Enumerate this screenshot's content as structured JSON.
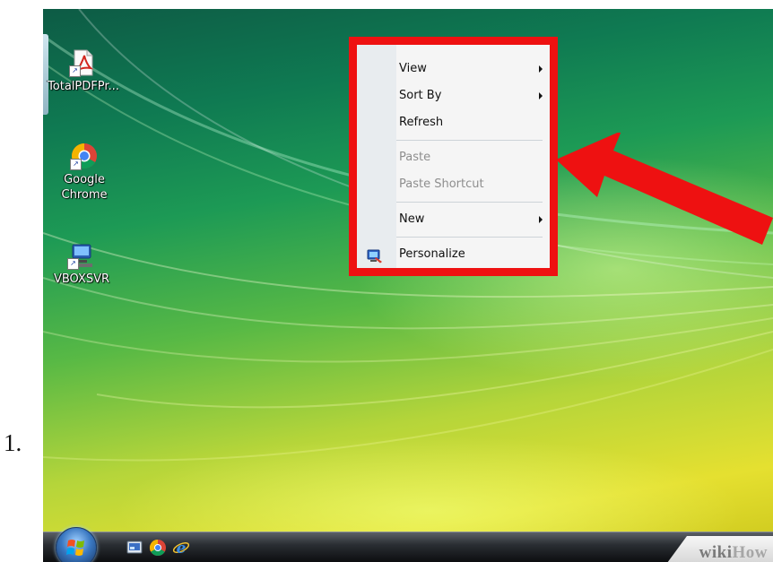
{
  "list_marker": "1.",
  "desktop": {
    "icons": [
      {
        "label": "TotalPDFPr...",
        "icon": "pdf-document-icon"
      },
      {
        "label": "Google\nChrome",
        "icon": "chrome-icon"
      },
      {
        "label": "VBOXSVR",
        "icon": "network-drive-icon"
      }
    ]
  },
  "context_menu": {
    "items": [
      {
        "label": "View",
        "enabled": true,
        "submenu": true
      },
      {
        "label": "Sort By",
        "enabled": true,
        "submenu": true
      },
      {
        "label": "Refresh",
        "enabled": true,
        "submenu": false
      },
      {
        "label": "Paste",
        "enabled": false,
        "submenu": false
      },
      {
        "label": "Paste Shortcut",
        "enabled": false,
        "submenu": false
      },
      {
        "label": "New",
        "enabled": true,
        "submenu": true
      },
      {
        "label": "Personalize",
        "enabled": true,
        "submenu": false,
        "icon": "personalize-icon"
      }
    ]
  },
  "taskbar": {
    "start_icon": "windows-logo-icon",
    "quick_launch": [
      "show-desktop-icon",
      "chrome-icon",
      "internet-explorer-icon"
    ]
  },
  "watermark": {
    "part1": "wiki",
    "part2": "How"
  },
  "colors": {
    "highlight_frame": "#ee1111",
    "annotation_arrow": "#ee1111",
    "menu_background": "#f5f5f5",
    "disabled_text": "#8e8e8e"
  }
}
